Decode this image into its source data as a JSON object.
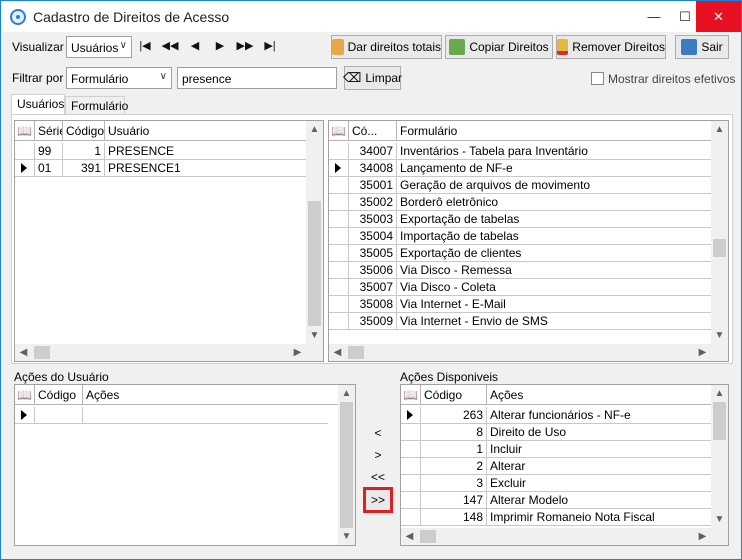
{
  "window": {
    "title": "Cadastro de Direitos de Acesso"
  },
  "toolbar": {
    "visualizar_label": "Visualizar",
    "visualizar_value": "Usuários",
    "dar_direitos": "Dar direitos totais",
    "copiar_direitos": "Copiar Direitos",
    "remover_direitos": "Remover Direitos",
    "sair": "Sair"
  },
  "filter": {
    "label": "Filtrar por",
    "field_value": "Formulário",
    "text_value": "presence",
    "limpar": "Limpar",
    "mostrar_efetivos": "Mostrar direitos efetivos"
  },
  "tabs": [
    "Usuários",
    "Formulário"
  ],
  "users_grid": {
    "headers": [
      "Série",
      "Código",
      "Usuário"
    ],
    "rows": [
      {
        "serie": "99",
        "codigo": "1",
        "usuario": "PRESENCE"
      },
      {
        "serie": "01",
        "codigo": "391",
        "usuario": "PRESENCE1"
      }
    ]
  },
  "forms_grid": {
    "headers": [
      "Có...",
      "Formulário"
    ],
    "rows": [
      {
        "codigo": "34007",
        "formulario": "Inventários - Tabela para Inventário"
      },
      {
        "codigo": "34008",
        "formulario": "Lançamento de NF-e"
      },
      {
        "codigo": "35001",
        "formulario": "Geração de arquivos de movimento"
      },
      {
        "codigo": "35002",
        "formulario": "Borderô eletrônico"
      },
      {
        "codigo": "35003",
        "formulario": "Exportação de tabelas"
      },
      {
        "codigo": "35004",
        "formulario": "Importação de tabelas"
      },
      {
        "codigo": "35005",
        "formulario": "Exportação de clientes"
      },
      {
        "codigo": "35006",
        "formulario": "Via Disco - Remessa"
      },
      {
        "codigo": "35007",
        "formulario": "Via Disco - Coleta"
      },
      {
        "codigo": "35008",
        "formulario": "Via Internet - E-Mail"
      },
      {
        "codigo": "35009",
        "formulario": "Via Internet - Envio de SMS"
      }
    ]
  },
  "acoes_usuario": {
    "title": "Ações do Usuário",
    "headers": [
      "Código",
      "Ações"
    ]
  },
  "acoes_disponiveis": {
    "title": "Ações Disponiveis",
    "headers": [
      "Código",
      "Ações"
    ],
    "rows": [
      {
        "codigo": "263",
        "acao": "Alterar funcionários - NF-e"
      },
      {
        "codigo": "8",
        "acao": "Direito de Uso"
      },
      {
        "codigo": "1",
        "acao": "Incluir"
      },
      {
        "codigo": "2",
        "acao": "Alterar"
      },
      {
        "codigo": "3",
        "acao": "Excluir"
      },
      {
        "codigo": "147",
        "acao": "Alterar Modelo"
      },
      {
        "codigo": "148",
        "acao": "Imprimir Romaneio Nota Fiscal"
      }
    ]
  },
  "move_buttons": [
    "<",
    ">",
    "<<",
    ">>"
  ]
}
